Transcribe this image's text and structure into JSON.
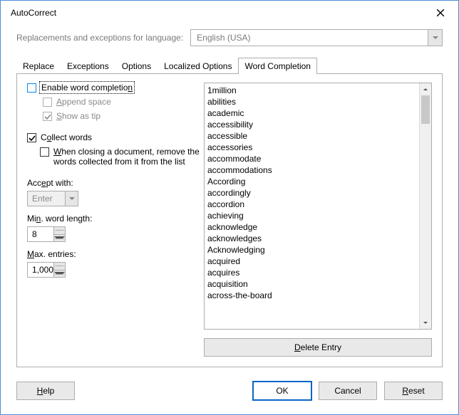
{
  "window": {
    "title": "AutoCorrect"
  },
  "lang": {
    "label": "Replacements and exceptions for language:",
    "value": "English (USA)"
  },
  "tabs": {
    "replace": "Replace",
    "exceptions": "Exceptions",
    "options": "Options",
    "localized": "Localized Options",
    "wordcompletion": "Word Completion"
  },
  "chk": {
    "enable_pre": "Enable word completio",
    "enable_mn": "n",
    "append_mn": "A",
    "append_post": "ppend space",
    "tip_mn": "S",
    "tip_post": "how as tip",
    "collect_pre": "C",
    "collect_mn": "o",
    "collect_post": "llect words",
    "remove_pre": "",
    "remove_mn": "W",
    "remove_post": "hen closing a document, remove the words collected from it from the list"
  },
  "labels": {
    "accept_pre": "Acc",
    "accept_mn": "e",
    "accept_post": "pt with:",
    "minlen_pre": "Mi",
    "minlen_mn": "n",
    "minlen_post": ". word length:",
    "maxent_pre": "",
    "maxent_mn": "M",
    "maxent_post": "ax. entries:"
  },
  "fields": {
    "accept": "Enter",
    "minlen": "8",
    "maxent": "1,000"
  },
  "words": [
    "1million",
    "abilities",
    "academic",
    "accessibility",
    "accessible",
    "accessories",
    "accommodate",
    "accommodations",
    "According",
    "accordingly",
    "accordion",
    "achieving",
    "acknowledge",
    "acknowledges",
    "Acknowledging",
    "acquired",
    "acquires",
    "acquisition",
    "across-the-board"
  ],
  "buttons": {
    "delete_pre": "",
    "delete_mn": "D",
    "delete_post": "elete Entry",
    "help_mn": "H",
    "help_post": "elp",
    "ok": "OK",
    "cancel": "Cancel",
    "reset_mn": "R",
    "reset_post": "eset"
  }
}
